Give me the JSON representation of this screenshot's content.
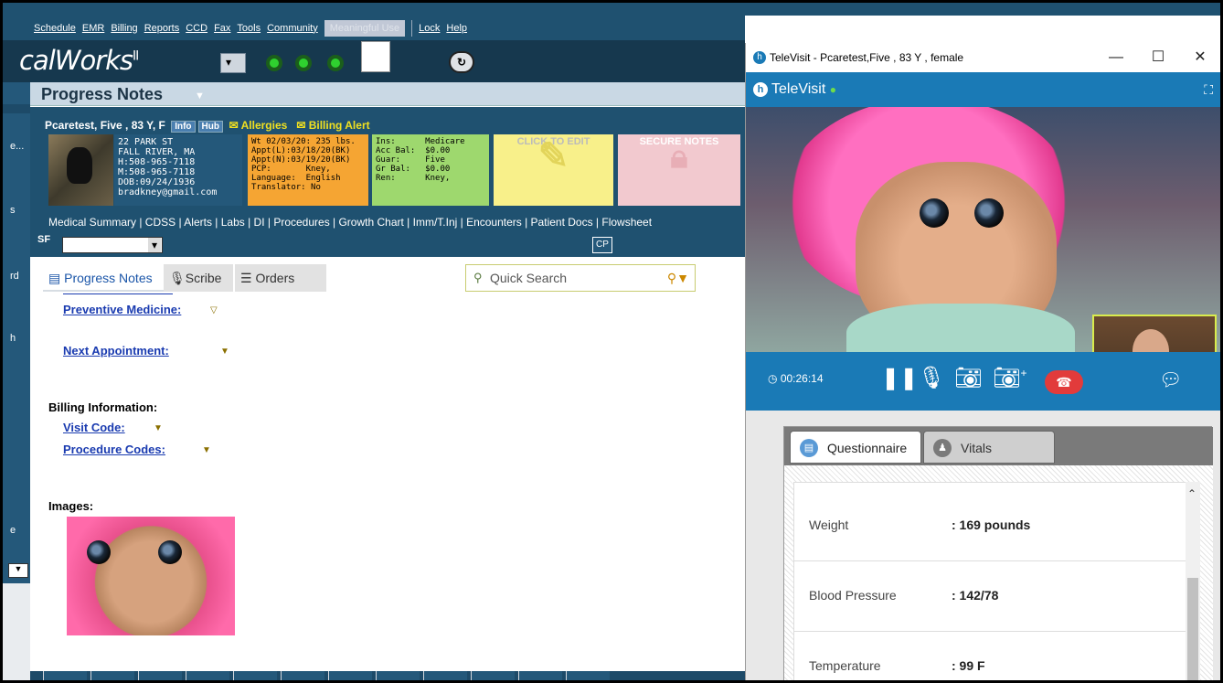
{
  "menubar": {
    "items": [
      "Schedule",
      "EMR",
      "Billing",
      "Reports",
      "CCD",
      "Fax",
      "Tools",
      "Community"
    ],
    "meaningful_use": "Meaningful Use",
    "lock": "Lock",
    "help": "Help"
  },
  "app": {
    "brand": "calWorks",
    "brand_sup": "II",
    "page_title": "Progress Notes",
    "status_dots_color": "#2fd12f"
  },
  "leftnav": {
    "letters": [
      "e...",
      "s",
      "rd",
      "h",
      "e"
    ]
  },
  "patient": {
    "name": "Pcaretest, Five , 83 Y, F",
    "info": "Info",
    "hub": "Hub",
    "allergies": "Allergies",
    "billing_alert": "Billing Alert",
    "address": "22 PARK ST\nFALL RIVER, MA\nH:508-965-7118\nM:508-965-7118\nDOB:09/24/1936\nbradkney@gmail.com",
    "vitals_box": "Wt 02/03/20: 235 lbs.\nAppt(L):03/18/20(BK)\nAppt(N):03/19/20(BK)\nPCP:       Kney,\nLanguage:  English\nTranslator: No",
    "billing_box": "Ins:      Medicare\nAcc Bal:  $0.00\nGuar:     Five\nGr Bal:   $0.00\nRen:      Kney,",
    "click_to_edit": "CLICK TO EDIT",
    "secure_notes": "SECURE NOTES"
  },
  "links": "Medical Summary | CDSS | Alerts | Labs | DI | Procedures | Growth Chart | Imm/T.Inj | Encounters | Patient Docs | Flowsheet",
  "sf_label": "SF",
  "cp_label": "CP",
  "tabs": {
    "progress_notes": "Progress Notes",
    "scribe": "Scribe",
    "orders": "Orders"
  },
  "search": {
    "placeholder": "Quick Search"
  },
  "note": {
    "preventive": "Preventive Medicine:",
    "next_appt": "Next Appointment:",
    "billing_info": "Billing Information:",
    "visit_code": "Visit Code:",
    "procedure_codes": "Procedure Codes:",
    "images": "Images:"
  },
  "televisit": {
    "window_title": "TeleVisit - Pcaretest,Five , 83 Y , female",
    "header": "TeleVisit",
    "timer": "00:26:14",
    "tabs": {
      "questionnaire": "Questionnaire",
      "vitals": "Vitals"
    },
    "rows": [
      {
        "label": "Weight",
        "value": ": 169 pounds"
      },
      {
        "label": "Blood Pressure",
        "value": ": 142/78"
      },
      {
        "label": "Temperature",
        "value": ": 99 F"
      }
    ],
    "colors": {
      "accent": "#1a7ab6",
      "hangup": "#e23b3b",
      "pip_border": "#d9ec4c"
    }
  }
}
